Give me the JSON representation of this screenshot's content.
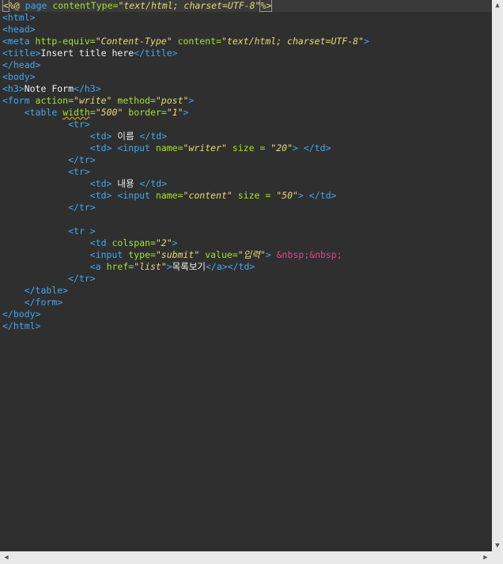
{
  "code": {
    "l1": {
      "open": "<",
      "pct": "%@",
      "page": " page ",
      "ct_attr": "contentType=",
      "ct_val": "\"text/html; charset=UTF-8\"",
      "close": "%>"
    },
    "l2": "<html>",
    "l3": "<head>",
    "l4": {
      "tag": "<meta",
      "a1": " http-equiv=",
      "v1": "\"Content-Type\"",
      "a2": " content=",
      "v2": "\"text/html; charset=UTF-8\"",
      "end": ">"
    },
    "l5": {
      "open": "<title>",
      "text": "Insert title here",
      "close": "</title>"
    },
    "l6": "</head>",
    "l7": "<body>",
    "l8": {
      "open": "<h3>",
      "text": "Note Form",
      "close": "</h3>"
    },
    "l9": {
      "tag": "<form",
      "a1": " action=",
      "v1": "\"write\"",
      "a2": " method=",
      "v2": "\"post\"",
      "end": ">"
    },
    "l10": {
      "indent": "    ",
      "tag": "<table",
      "a1": "width",
      "eq1": "=",
      "v1": "\"500\"",
      "a2": " border=",
      "v2": "\"1\"",
      "end": ">"
    },
    "l11": {
      "indent": "            ",
      "tag": "<tr>"
    },
    "l12": {
      "indent": "                ",
      "open": "<td>",
      "text": " 이름 ",
      "close": "</td>"
    },
    "l13": {
      "indent": "                ",
      "open": "<td>",
      "sp": " ",
      "tag": "<input",
      "a1": " name=",
      "v1": "\"writer\"",
      "a2": " size = ",
      "v2": "\"20\"",
      "end": ">",
      "sp2": " ",
      "close": "</td>"
    },
    "l14": {
      "indent": "            ",
      "tag": "</tr>"
    },
    "l15": {
      "indent": "            ",
      "tag": "<tr>"
    },
    "l16": {
      "indent": "                ",
      "open": "<td>",
      "text": " 내용 ",
      "close": "</td>"
    },
    "l17": {
      "indent": "                ",
      "open": "<td>",
      "sp": " ",
      "tag": "<input",
      "a1": " name=",
      "v1": "\"content\"",
      "a2": " size = ",
      "v2": "\"50\"",
      "end": ">",
      "sp2": " ",
      "close": "</td>"
    },
    "l18": {
      "indent": "            ",
      "tag": "</tr>"
    },
    "l20": {
      "indent": "            ",
      "tag": "<tr >"
    },
    "l21": {
      "indent": "                ",
      "tag": "<td",
      "a1": " colspan=",
      "v1": "\"2\"",
      "end": ">"
    },
    "l22": {
      "indent": "                ",
      "tag": "<input",
      "a1": " type=",
      "v1": "\"submit\"",
      "a2": " value=",
      "v2": "\"입력\"",
      "end": ">",
      "sp": " ",
      "ent": "&nbsp;&nbsp;"
    },
    "l23": {
      "indent": "                ",
      "tag": "<a",
      "a1": " href=",
      "v1": "\"list\"",
      "end": ">",
      "text": "목록보기",
      "close": "</a></td>"
    },
    "l24": {
      "indent": "            ",
      "tag": "</tr>"
    },
    "l25": {
      "indent": "    ",
      "tag": "</table>"
    },
    "l26": {
      "indent": "    ",
      "tag": "</form>"
    },
    "l27": "</body>",
    "l28": "</html>"
  },
  "scroll": {
    "up": "▲",
    "down": "▼",
    "left": "◀",
    "right": "▶"
  }
}
